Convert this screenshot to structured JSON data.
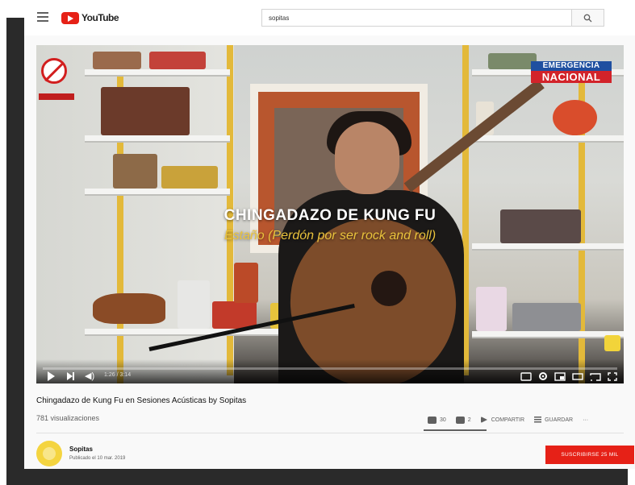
{
  "header": {
    "logo_text": "YouTube",
    "search": {
      "value": "sopitas"
    }
  },
  "video": {
    "overlay_title": "CHINGADAZO DE KUNG FU",
    "overlay_subtitle": "Estaño (Perdón por ser rock and roll)",
    "badge_line1": "EMERGENCIA",
    "badge_line2": "NACIONAL",
    "time": "1:26 / 3:14",
    "progress": 0.0,
    "accent_color": "#e62117"
  },
  "info": {
    "title": "Chingadazo de Kung Fu en Sesiones Acústicas by Sopitas",
    "views": "781 visualizaciones",
    "likes": "30",
    "dislikes": "2",
    "share_label": "COMPARTIR",
    "save_label": "GUARDAR",
    "more_label": "···"
  },
  "channel": {
    "name": "Sopitas",
    "published": "Publicado el 10 mar. 2019",
    "subscribe_label": "SUSCRIBIRSE 25 MIL"
  },
  "icons": [
    "menu-icon",
    "youtube-logo-icon",
    "search-icon",
    "play-icon",
    "next-icon",
    "volume-icon",
    "like-icon",
    "dislike-icon",
    "share-icon",
    "save-icon",
    "settings-icon",
    "miniplayer-icon",
    "theater-icon",
    "cast-icon",
    "fullscreen-icon"
  ]
}
